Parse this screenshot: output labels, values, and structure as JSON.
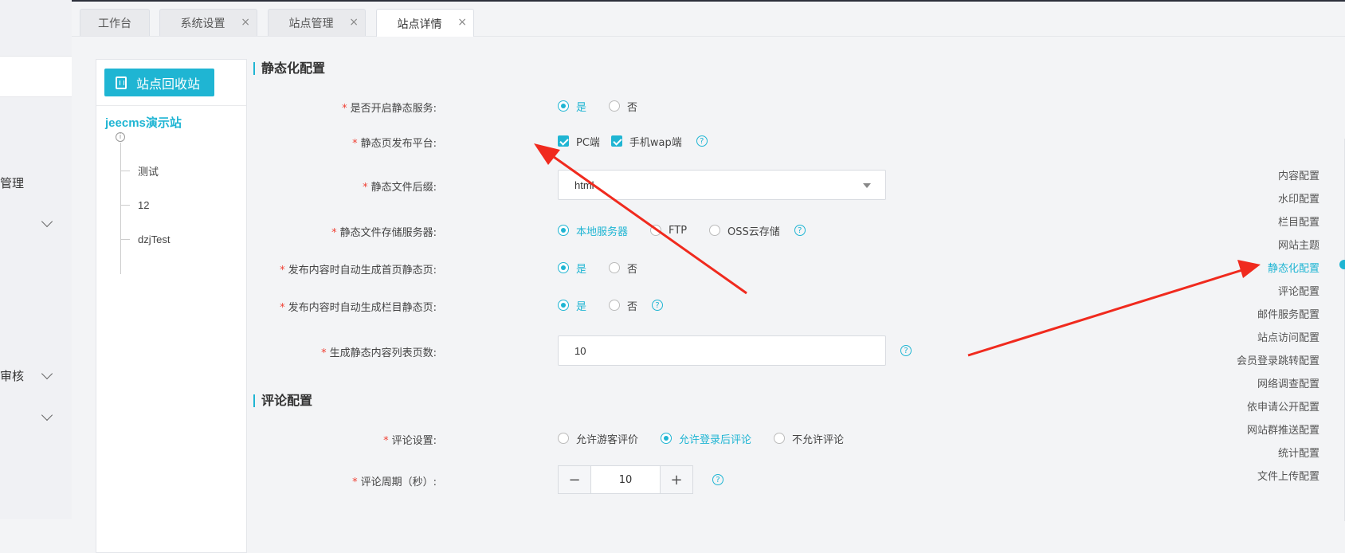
{
  "sidebar": {
    "labels": [
      "管理",
      "审核"
    ]
  },
  "tabs": [
    {
      "label": "工作台",
      "closable": false,
      "active": false
    },
    {
      "label": "系统设置",
      "closable": true,
      "active": false
    },
    {
      "label": "站点管理",
      "closable": true,
      "active": false
    },
    {
      "label": "站点详情",
      "closable": true,
      "active": true
    }
  ],
  "tabs_close_glyph": "×",
  "tree": {
    "recycle_button": "站点回收站",
    "site_name": "jeecms演示站",
    "info_glyph": "i",
    "nodes": [
      "测试",
      "12",
      "dzjTest"
    ]
  },
  "static": {
    "title": "静态化配置",
    "rows": {
      "enable": {
        "label": "是否开启静态服务:",
        "options": [
          "是",
          "否"
        ],
        "selected": "是"
      },
      "platform": {
        "label": "静态页发布平台:",
        "options": [
          "PC端",
          "手机wap端"
        ],
        "checked": [
          "PC端",
          "手机wap端"
        ]
      },
      "suffix": {
        "label": "静态文件后缀:",
        "value": "html"
      },
      "storage": {
        "label": "静态文件存储服务器:",
        "options": [
          "本地服务器",
          "FTP",
          "OSS云存储"
        ],
        "selected": "本地服务器"
      },
      "home_gen": {
        "label": "发布内容时自动生成首页静态页:",
        "options": [
          "是",
          "否"
        ],
        "selected": "是"
      },
      "channel_gen": {
        "label": "发布内容时自动生成栏目静态页:",
        "options": [
          "是",
          "否"
        ],
        "selected": "是"
      },
      "pages": {
        "label": "生成静态内容列表页数:",
        "value": "10"
      }
    }
  },
  "comment": {
    "title": "评论配置",
    "rows": {
      "setting": {
        "label": "评论设置:",
        "options": [
          "允许游客评价",
          "允许登录后评论",
          "不允许评论"
        ],
        "selected": "允许登录后评论"
      },
      "cycle": {
        "label": "评论周期（秒）:",
        "value": "10",
        "minus": "−",
        "plus": "+"
      }
    }
  },
  "required_mark": "*",
  "help_glyph": "?",
  "anchor_nav": {
    "items": [
      "内容配置",
      "水印配置",
      "栏目配置",
      "网站主题",
      "静态化配置",
      "评论配置",
      "邮件服务配置",
      "站点访问配置",
      "会员登录跳转配置",
      "网络调查配置",
      "依申请公开配置",
      "网站群推送配置",
      "统计配置",
      "文件上传配置"
    ],
    "active": "静态化配置"
  },
  "colors": {
    "accent": "#1fb5d3",
    "required": "#f04134",
    "annotation_arrow": "#f02a1e"
  }
}
